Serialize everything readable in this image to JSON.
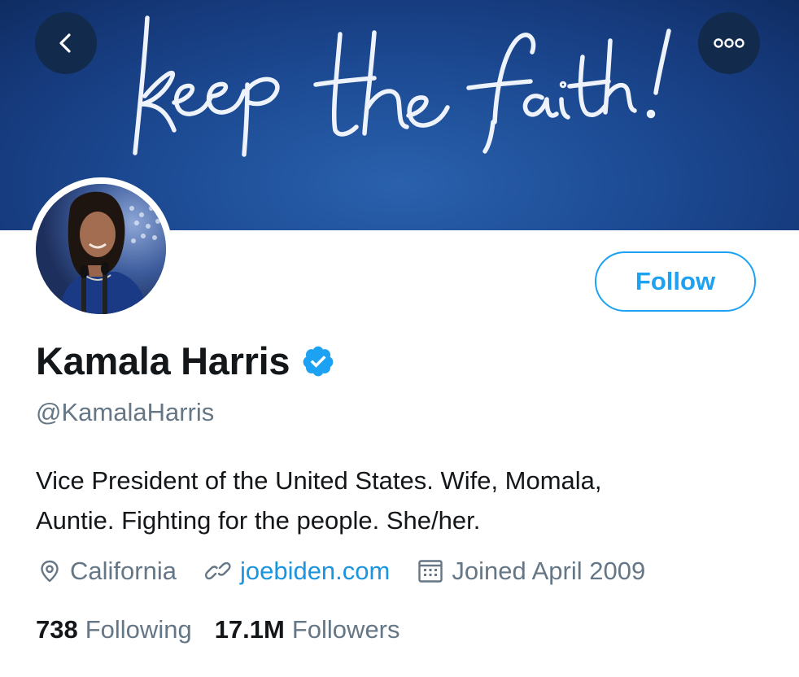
{
  "header": {
    "banner_script_text": "keep the faith!",
    "back_icon": "chevron-left-icon",
    "more_icon": "ellipsis-icon"
  },
  "profile": {
    "name": "Kamala Harris",
    "verified_icon": "verified-badge-icon",
    "handle": "@KamalaHarris",
    "bio_lines": [
      "Vice President of the United States. Wife, Momala,",
      "Auntie. Fighting for the people. She/her."
    ],
    "location": "California",
    "website": "joebiden.com",
    "joined": "Joined April 2009",
    "following_count": "738",
    "following_label": "Following",
    "followers_count": "17.1M",
    "followers_label": "Followers"
  },
  "actions": {
    "follow_label": "Follow"
  },
  "colors": {
    "accent": "#1da1f2",
    "link": "#1b95e0",
    "secondary_text": "#657786",
    "banner_blue": "#1c4a93"
  }
}
